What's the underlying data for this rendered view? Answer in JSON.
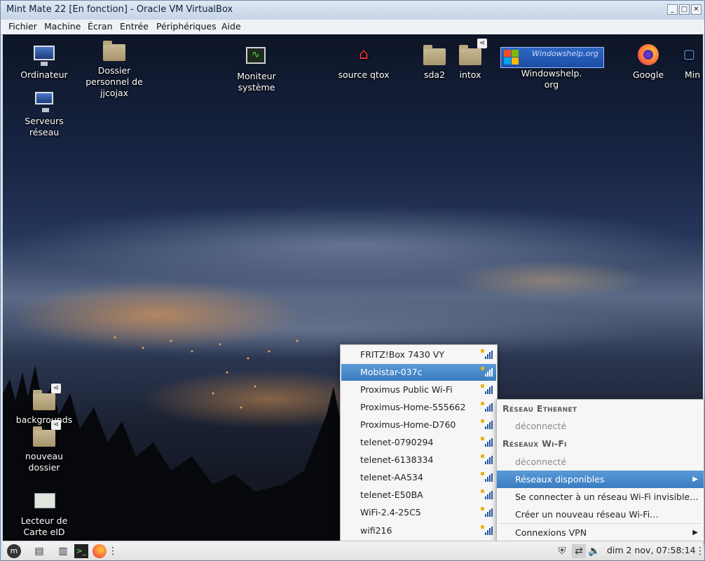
{
  "window": {
    "title": "Mint Mate 22 [En fonction] - Oracle VM VirtualBox",
    "controls": [
      "_",
      "□",
      "✕"
    ]
  },
  "menubar": [
    "Fichier",
    "Machine",
    "Écran",
    "Entrée",
    "Périphériques",
    "Aide"
  ],
  "desktop": {
    "icons": [
      {
        "label": "Ordinateur",
        "icon": "computer-icon"
      },
      {
        "label": "Dossier\npersonnel de\njjcojax",
        "icon": "home-folder-icon"
      },
      {
        "label": "Moniteur\nsystème",
        "icon": "system-monitor-icon"
      },
      {
        "label": "source qtox",
        "icon": "qtox-icon"
      },
      {
        "label": "sda2",
        "icon": "folder-icon"
      },
      {
        "label": "intox",
        "icon": "shared-folder-icon"
      },
      {
        "label": "Windowshelp.\norg",
        "icon": "windowshelp-icon"
      },
      {
        "label": "Google",
        "icon": "firefox-icon"
      },
      {
        "label": "Min",
        "icon": "app-icon"
      },
      {
        "label": "Serveurs\nréseau",
        "icon": "network-servers-icon"
      },
      {
        "label": "backgrounds",
        "icon": "shared-folder-icon"
      },
      {
        "label": "nouveau\ndossier",
        "icon": "shared-folder-icon"
      },
      {
        "label": "Lecteur de\nCarte eID",
        "icon": "eid-reader-icon"
      }
    ],
    "windowshelp_logo_text": "Windowshelp.org"
  },
  "wifi_list": {
    "selected": "Mobistar-037c",
    "networks": [
      "FRITZ!Box 7430 VY",
      "Mobistar-037c",
      "Proximus Public Wi-Fi",
      "Proximus-Home-555662",
      "Proximus-Home-D760",
      "telenet-0790294",
      "telenet-6138334",
      "telenet-AA534",
      "telenet-E50BA",
      "WiFi-2.4-25C5",
      "wifi216"
    ]
  },
  "network_menu": {
    "ethernet_header": "Réseau Ethernet",
    "ethernet_status": "déconnecté",
    "wifi_header": "Réseaux Wi-Fi",
    "wifi_status": "déconnecté",
    "available_networks": "Réseaux disponibles",
    "connect_hidden": "Se connecter à un réseau Wi-Fi invisible…",
    "create_new": "Créer un nouveau réseau Wi-Fi…",
    "vpn": "Connexions VPN"
  },
  "taskbar": {
    "clock": "dim  2 nov, 07:58:14"
  }
}
